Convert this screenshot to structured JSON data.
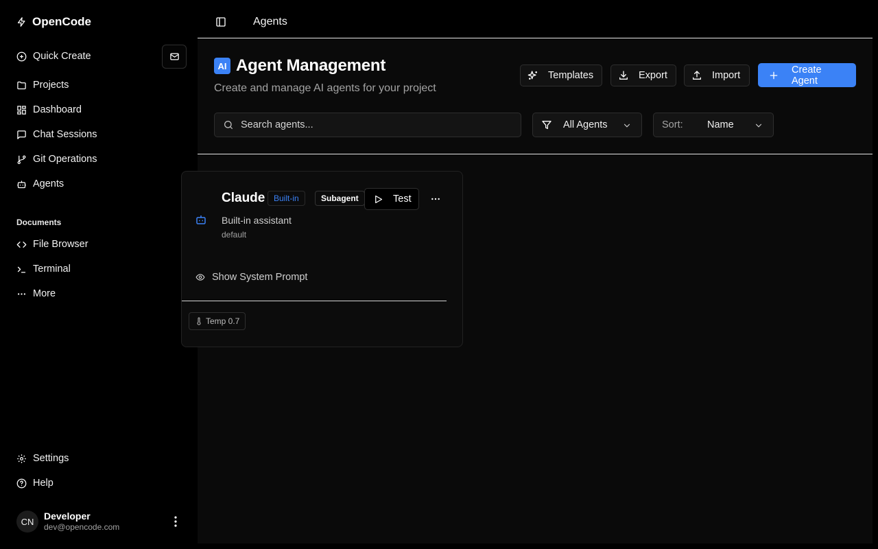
{
  "sidebar": {
    "brand": "OpenCode",
    "items": [
      {
        "label": "Quick Create",
        "icon": "plus-circle-icon"
      },
      {
        "label": "Projects",
        "icon": "folder-icon"
      },
      {
        "label": "Dashboard",
        "icon": "dashboard-icon"
      },
      {
        "label": "Chat Sessions",
        "icon": "chat-icon"
      },
      {
        "label": "Git Operations",
        "icon": "git-branch-icon"
      },
      {
        "label": "Agents",
        "icon": "bot-icon"
      }
    ],
    "documents_label": "Documents",
    "documents": [
      {
        "label": "File Browser",
        "icon": "code-icon"
      },
      {
        "label": "Terminal",
        "icon": "terminal-icon"
      },
      {
        "label": "More",
        "icon": "ellipsis-icon"
      }
    ],
    "footer_items": [
      {
        "label": "Settings",
        "icon": "gear-icon"
      },
      {
        "label": "Help",
        "icon": "help-circle-icon"
      }
    ],
    "user": {
      "initials": "CN",
      "name": "Developer",
      "email": "dev@opencode.com"
    }
  },
  "topbar": {
    "breadcrumb": "Agents"
  },
  "header": {
    "badge": "AI",
    "title": "Agent Management",
    "subtitle": "Create and manage AI agents for your project",
    "actions": {
      "templates": "Templates",
      "export": "Export",
      "import": "Import",
      "create": "Create Agent"
    }
  },
  "toolbar": {
    "search_placeholder": "Search agents...",
    "filter_value": "All Agents",
    "sort_label": "Sort:",
    "sort_value": "Name"
  },
  "agents": [
    {
      "name": "Claude",
      "badges": [
        "Built-in",
        "Subagent"
      ],
      "test_label": "Test",
      "description": "Built-in assistant",
      "model": "default",
      "prompt_toggle": "Show System Prompt",
      "temp_chip": "Temp 0.7"
    }
  ],
  "colors": {
    "accent": "#3b82f6",
    "background": "#0a0a0a",
    "sidebar": "#000000"
  }
}
